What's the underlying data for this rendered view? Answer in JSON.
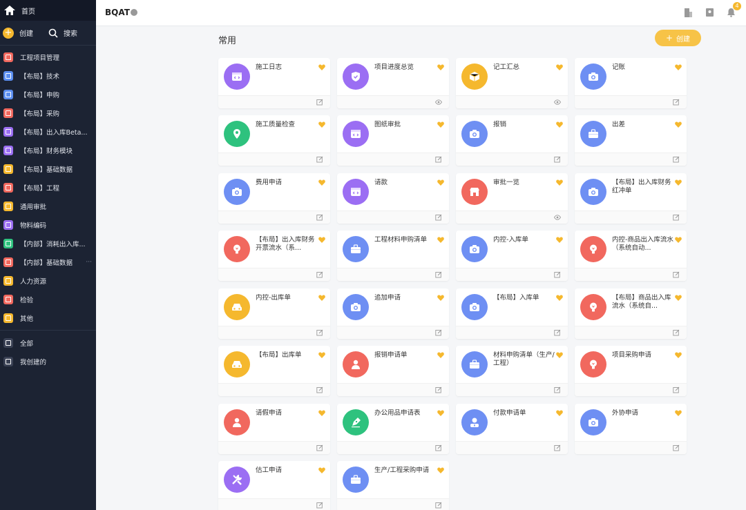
{
  "sidebar": {
    "home_label": "首页",
    "create_label": "创建",
    "search_label": "搜索",
    "items": [
      {
        "label": "工程项目管理",
        "color": "#f1685e",
        "more": ""
      },
      {
        "label": "【布局】技术",
        "color": "#5b8ef0",
        "more": ""
      },
      {
        "label": "【布局】申购",
        "color": "#5b8ef0",
        "more": ""
      },
      {
        "label": "【布局】采购",
        "color": "#f1685e",
        "more": ""
      },
      {
        "label": "【布局】出入库Beta...",
        "color": "#9b6ef3",
        "more": ""
      },
      {
        "label": "【布局】财务模块",
        "color": "#9b6ef3",
        "more": ""
      },
      {
        "label": "【布局】基础数据",
        "color": "#f5b82e",
        "more": ""
      },
      {
        "label": "【布局】工程",
        "color": "#f1685e",
        "more": ""
      },
      {
        "label": "通用审批",
        "color": "#f5b82e",
        "more": ""
      },
      {
        "label": "物料编码",
        "color": "#9b6ef3",
        "more": ""
      },
      {
        "label": "【内部】消耗出入库...",
        "color": "#2ec27e",
        "more": ""
      },
      {
        "label": "【内部】基础数据",
        "color": "#f1685e",
        "more": "···"
      },
      {
        "label": "人力资源",
        "color": "#f5b82e",
        "more": ""
      },
      {
        "label": "检验",
        "color": "#f1685e",
        "more": ""
      },
      {
        "label": "其他",
        "color": "#f5b82e",
        "more": ""
      }
    ],
    "bottom_items": [
      {
        "label": "全部"
      },
      {
        "label": "我创建的"
      }
    ]
  },
  "header": {
    "app_title": "BQAT",
    "notification_count": "4"
  },
  "main": {
    "section_title": "常用",
    "create_button": "创建",
    "cards": [
      {
        "name": "施工日志",
        "color": "#9b6ef3",
        "icon": "code",
        "foot": "edit"
      },
      {
        "name": "项目进度总览",
        "color": "#9b6ef3",
        "icon": "shield",
        "foot": "view"
      },
      {
        "name": "记工汇总",
        "color": "#f5b82e",
        "icon": "box",
        "foot": "view"
      },
      {
        "name": "记账",
        "color": "#6e8ff3",
        "icon": "camera",
        "foot": "edit"
      },
      {
        "name": "施工质量检查",
        "color": "#2ec27e",
        "icon": "pin",
        "foot": "edit"
      },
      {
        "name": "图纸审批",
        "color": "#9b6ef3",
        "icon": "code",
        "foot": "edit"
      },
      {
        "name": "报销",
        "color": "#6e8ff3",
        "icon": "camera",
        "foot": "edit"
      },
      {
        "name": "出差",
        "color": "#6e8ff3",
        "icon": "case",
        "foot": "edit"
      },
      {
        "name": "费用申请",
        "color": "#6e8ff3",
        "icon": "camera",
        "foot": "edit"
      },
      {
        "name": "请款",
        "color": "#9b6ef3",
        "icon": "code",
        "foot": "edit"
      },
      {
        "name": "审批一览",
        "color": "#f1685e",
        "icon": "shop",
        "foot": "view"
      },
      {
        "name": "【布局】出入库财务红冲单",
        "color": "#6e8ff3",
        "icon": "camera",
        "foot": "edit"
      },
      {
        "name": "【布局】出入库财务开票流水（系...",
        "color": "#f1685e",
        "icon": "bulb",
        "foot": "edit"
      },
      {
        "name": "工程材料申购清单",
        "color": "#6e8ff3",
        "icon": "case",
        "foot": "edit"
      },
      {
        "name": "内控-入库单",
        "color": "#6e8ff3",
        "icon": "camera",
        "foot": "edit"
      },
      {
        "name": "内控-商品出入库流水（系统自动...",
        "color": "#f1685e",
        "icon": "bulb",
        "foot": "edit"
      },
      {
        "name": "内控-出库单",
        "color": "#f5b82e",
        "icon": "car",
        "foot": "edit"
      },
      {
        "name": "追加申请",
        "color": "#6e8ff3",
        "icon": "camera",
        "foot": "edit"
      },
      {
        "name": "【布局】入库单",
        "color": "#6e8ff3",
        "icon": "camera",
        "foot": "edit"
      },
      {
        "name": "【布局】商品出入库流水（系统自...",
        "color": "#f1685e",
        "icon": "bulb",
        "foot": "edit"
      },
      {
        "name": "【布局】出库单",
        "color": "#f5b82e",
        "icon": "car",
        "foot": "edit"
      },
      {
        "name": "报销申请单",
        "color": "#f1685e",
        "icon": "person",
        "foot": "edit"
      },
      {
        "name": "材料申购清单（生产/工程）",
        "color": "#6e8ff3",
        "icon": "case",
        "foot": "edit"
      },
      {
        "name": "项目采购申请",
        "color": "#f1685e",
        "icon": "bulb",
        "foot": "edit"
      },
      {
        "name": "请假申请",
        "color": "#f1685e",
        "icon": "person",
        "foot": "edit"
      },
      {
        "name": "办公用品申请表",
        "color": "#2ec27e",
        "icon": "pen",
        "foot": "edit"
      },
      {
        "name": "付款申请单",
        "color": "#6e8ff3",
        "icon": "user",
        "foot": "edit"
      },
      {
        "name": "外协申请",
        "color": "#6e8ff3",
        "icon": "camera",
        "foot": "edit"
      },
      {
        "name": "估工申请",
        "color": "#9b6ef3",
        "icon": "tools",
        "foot": "edit"
      },
      {
        "name": "生产/工程采购申请",
        "color": "#6e8ff3",
        "icon": "case",
        "foot": "edit"
      }
    ]
  },
  "colors": {
    "accent": "#f7c347",
    "sidebar_bg": "#1c2333"
  }
}
